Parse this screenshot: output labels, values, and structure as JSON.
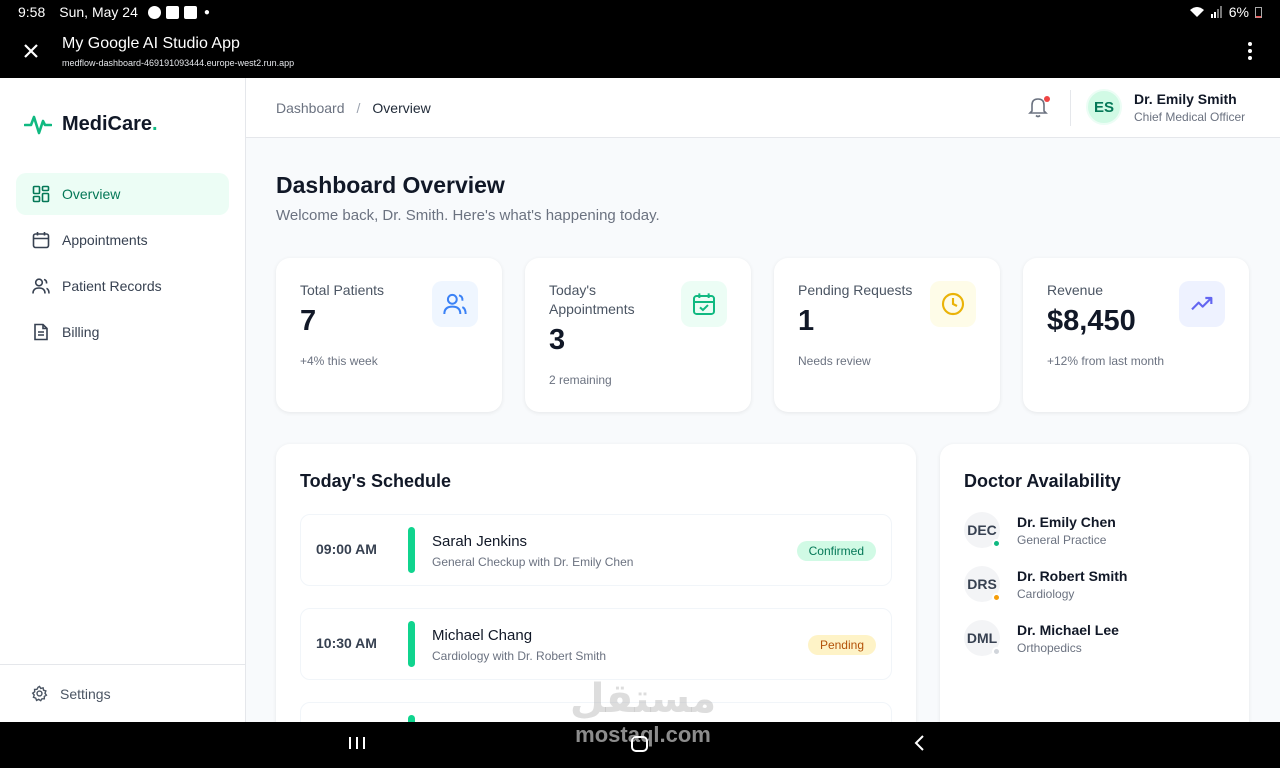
{
  "statusbar": {
    "time": "9:58",
    "date": "Sun, May 24",
    "battery": "6%"
  },
  "appbar": {
    "title": "My Google AI Studio App",
    "url": "medflow-dashboard-469191093444.europe-west2.run.app"
  },
  "brand": {
    "name": "MediCare",
    "dot": ".",
    "accent": "#10b981"
  },
  "sidebar": {
    "items": [
      {
        "label": "Overview",
        "icon": "grid-icon",
        "active": true
      },
      {
        "label": "Appointments",
        "icon": "calendar-icon"
      },
      {
        "label": "Patient Records",
        "icon": "users-icon"
      },
      {
        "label": "Billing",
        "icon": "file-icon"
      }
    ],
    "settings": "Settings"
  },
  "topbar": {
    "breadcrumb": [
      "Dashboard",
      "/",
      "Overview"
    ],
    "user": {
      "initials": "ES",
      "name": "Dr. Emily Smith",
      "role": "Chief Medical Officer"
    }
  },
  "header": {
    "title": "Dashboard Overview",
    "subtitle": "Welcome back, Dr. Smith. Here's what's happening today."
  },
  "stats": [
    {
      "label": "Total Patients",
      "value": "7",
      "foot": "+4% this week",
      "icon": "users-icon",
      "color": "#3b82f6",
      "bg": "#eff6ff"
    },
    {
      "label": "Today's Appointments",
      "value": "3",
      "foot": "2 remaining",
      "icon": "calendar-check-icon",
      "color": "#10b981",
      "bg": "#ecfdf5"
    },
    {
      "label": "Pending Requests",
      "value": "1",
      "foot": "Needs review",
      "icon": "clock-icon",
      "color": "#eab308",
      "bg": "#fefce8"
    },
    {
      "label": "Revenue",
      "value": "$8,450",
      "foot": "+12% from last month",
      "icon": "trending-up-icon",
      "color": "#6366f1",
      "bg": "#eef2ff"
    }
  ],
  "schedule": {
    "title": "Today's Schedule",
    "items": [
      {
        "time": "09:00 AM",
        "patient": "Sarah Jenkins",
        "desc": "General Checkup with Dr. Emily Chen",
        "status": "Confirmed"
      },
      {
        "time": "10:30 AM",
        "patient": "Michael Chang",
        "desc": "Cardiology with Dr. Robert Smith",
        "status": "Pending"
      }
    ]
  },
  "availability": {
    "title": "Doctor Availability",
    "doctors": [
      {
        "initials": "DEC",
        "name": "Dr. Emily Chen",
        "specialty": "General Practice",
        "status_color": "#10b981"
      },
      {
        "initials": "DRS",
        "name": "Dr. Robert Smith",
        "specialty": "Cardiology",
        "status_color": "#f59e0b"
      },
      {
        "initials": "DML",
        "name": "Dr. Michael Lee",
        "specialty": "Orthopedics",
        "status_color": "#d1d5db"
      }
    ]
  },
  "watermark": {
    "arabic": "مستقل",
    "latin": "mostaql.com"
  }
}
